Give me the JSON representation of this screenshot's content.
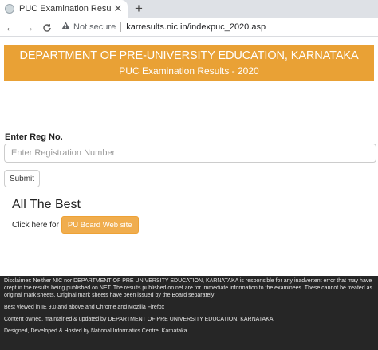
{
  "browser": {
    "tab_title": "PUC Examination Results - 2020",
    "tab_close": "✕",
    "new_tab": "+",
    "back": "←",
    "forward": "→",
    "reload": "C",
    "security_icon": "warning-triangle",
    "security_text": "Not secure",
    "url": "karresults.nic.in/indexpuc_2020.asp"
  },
  "header": {
    "title": "DEPARTMENT OF PRE-UNIVERSITY EDUCATION, KARNATAKA",
    "subtitle": "PUC Examination Results - 2020",
    "background_color": "#e9a135"
  },
  "form": {
    "label": "Enter Reg No.",
    "placeholder": "Enter Registration Number",
    "value": "",
    "submit_label": "Submit"
  },
  "content": {
    "best_wishes": "All The Best",
    "click_text": "Click here for",
    "board_button": "PU Board Web site",
    "board_button_color": "#f0ad4e"
  },
  "footer": {
    "disclaimer": "Disclaimer: Neither NIC nor DEPARTMENT OF PRE UNIVERSITY EDUCATION, KARNATAKA is responsible for any inadvertent error that may have crept in the results being published on NET. The results published on net are for immediate information to the examinees. These cannot be treated as original mark sheets. Original mark sheets have been issued by the Board separately",
    "browser_note": "Best viewed in IE 9.0 and above and Chrome and Mozilla Firefox",
    "owned": "Content owned, maintained & updated by DEPARTMENT OF PRE UNIVERSITY EDUCATION, KARNATAKA",
    "hosted": "Designed, Developed & Hosted by National Informatics Centre, Karnataka",
    "background_color": "#262626"
  }
}
